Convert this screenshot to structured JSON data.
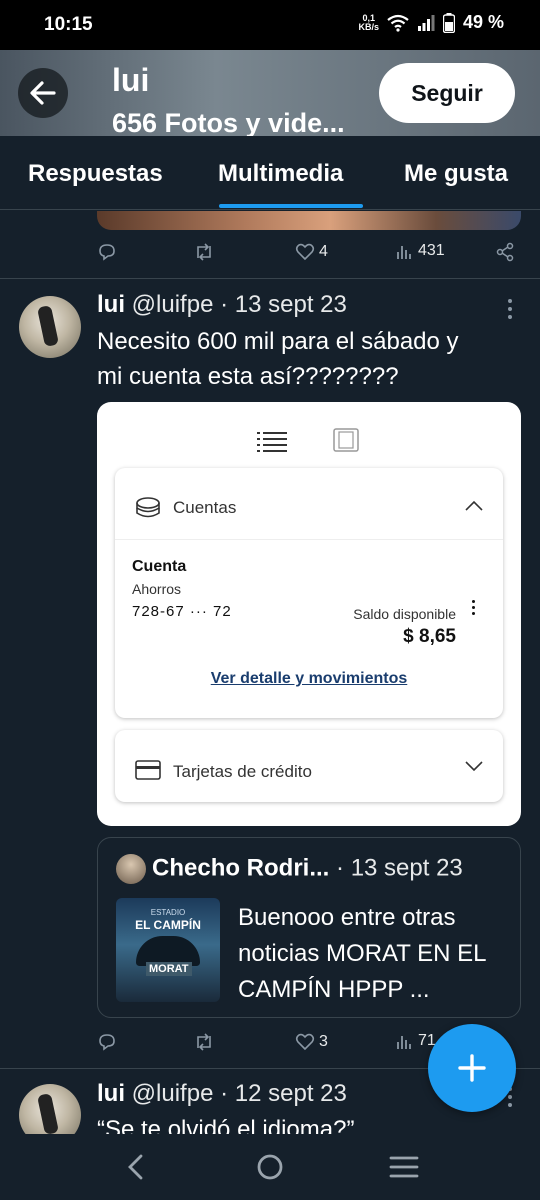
{
  "status_bar": {
    "time": "10:15",
    "speed_value": "0,1",
    "speed_unit": "KB/s",
    "battery": "49 %"
  },
  "header": {
    "name": "lui",
    "subtitle": "656 Fotos y vide..."
  },
  "follow_label": "Seguir",
  "tabs": [
    {
      "label": "Respuestas"
    },
    {
      "label": "Multimedia"
    },
    {
      "label": "Me gusta"
    }
  ],
  "prev_tweet": {
    "likes": "4",
    "views": "431"
  },
  "tweet1": {
    "name": "lui",
    "handle": "@luifpe",
    "date": "13 sept 23",
    "text_line1": "Necesito 600 mil para el sábado y",
    "text_line2": "mi cuenta esta así????????",
    "likes": "3",
    "views": "71"
  },
  "bank": {
    "accounts_title": "Cuentas",
    "account_label": "Cuenta",
    "account_type": "Ahorros",
    "account_number": "728-67 ··· 72",
    "balance_label": "Saldo disponible",
    "balance_value": "$ 8,65",
    "detail_link": "Ver detalle y movimientos",
    "cards_title": "Tarjetas de crédito"
  },
  "quote": {
    "name": "Checho Rodri...",
    "date": "13 sept 23",
    "text": "Buenooo entre otras noticias MORAT EN EL CAMPÍN HPPP ...",
    "thumb_line1": "ESTADIO",
    "thumb_line2": "EL CAMPÍN",
    "thumb_line3": "MORAT"
  },
  "tweet2": {
    "name": "lui",
    "handle": "@luifpe",
    "date": "12 sept 23",
    "text_line1": "“Se te olvidó el idioma?”"
  },
  "colors": {
    "background": "#15202b",
    "accent": "#1d9bf0",
    "muted": "#8b98a5",
    "divider": "#38444d"
  }
}
